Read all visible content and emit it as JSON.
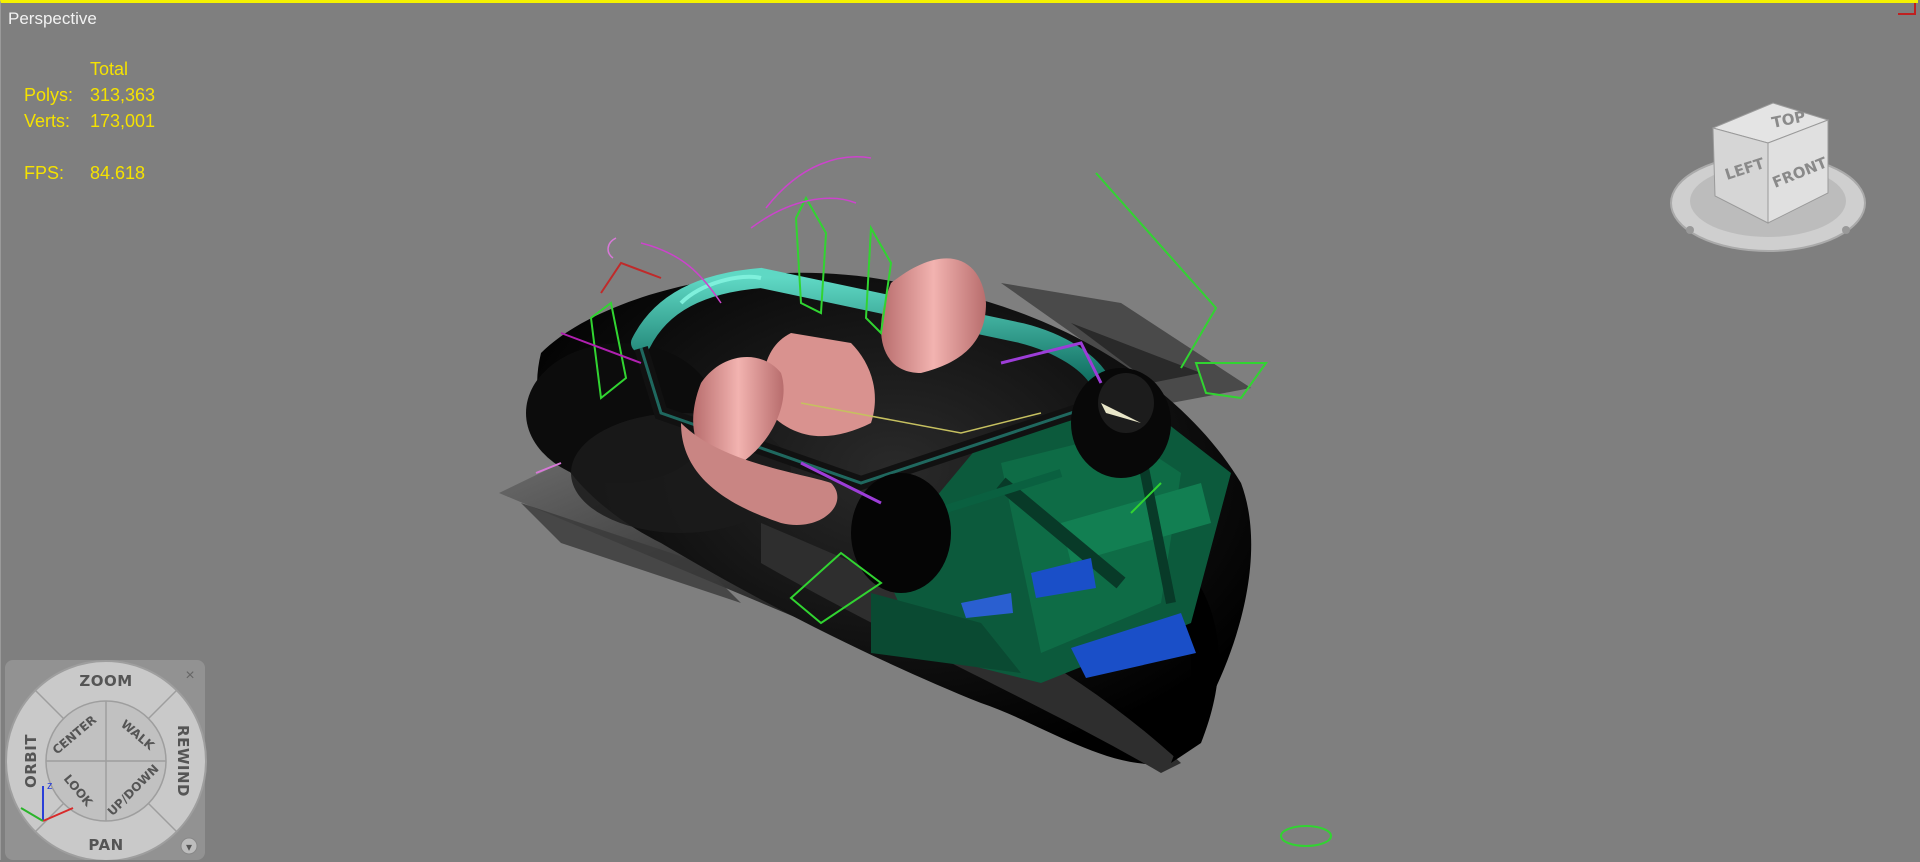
{
  "viewport": {
    "label": "Perspective",
    "stats": {
      "header": "Total",
      "polys_label": "Polys:",
      "polys_value": "313,363",
      "verts_label": "Verts:",
      "verts_value": "173,001",
      "fps_label": "FPS:",
      "fps_value": "84.618"
    },
    "border_color": "#f5f200",
    "background_color": "#7f7f7f"
  },
  "viewcube": {
    "top": "TOP",
    "left": "LEFT",
    "front": "FRONT"
  },
  "steering_wheel": {
    "zoom": "ZOOM",
    "orbit": "ORBIT",
    "rewind": "REWIND",
    "pan": "PAN",
    "center": "CENTER",
    "walk": "WALK",
    "look": "LOOK",
    "updown": "UP/DOWN",
    "close_glyph": "×",
    "menu_glyph": "▾",
    "axis_z": "z"
  },
  "icons": [
    "viewcube-icon",
    "steering-wheel-icon",
    "close-icon",
    "chevron-down-icon"
  ]
}
